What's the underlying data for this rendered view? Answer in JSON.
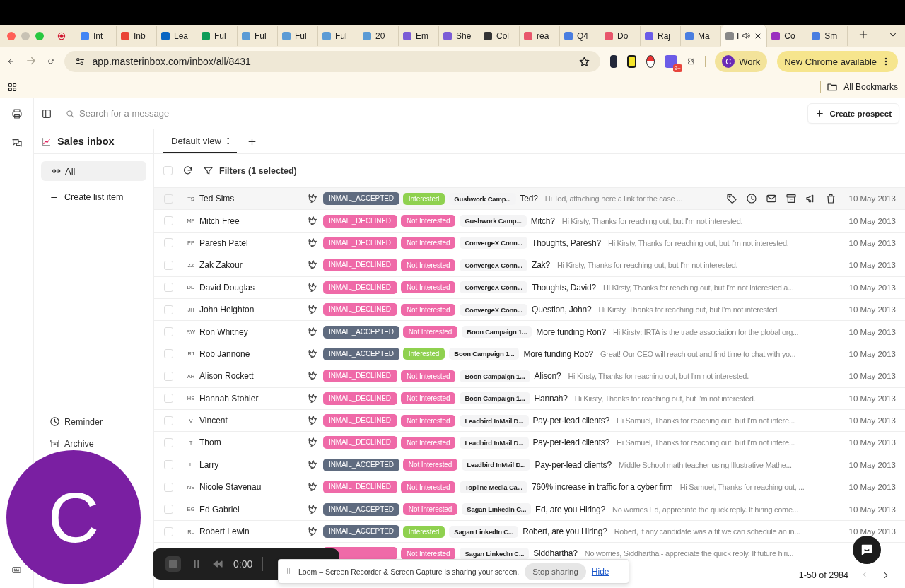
{
  "browser": {
    "tabs": [
      {
        "label": "Int",
        "color": "#4285f4",
        "selected": false
      },
      {
        "label": "Inb",
        "color": "#ea4335",
        "selected": false
      },
      {
        "label": "Lea",
        "color": "#0a66c2",
        "selected": false
      },
      {
        "label": "Ful",
        "color": "#0f9d58",
        "selected": false
      },
      {
        "label": "Ful",
        "color": "#5b9bd5",
        "selected": false
      },
      {
        "label": "Ful",
        "color": "#5b9bd5",
        "selected": false
      },
      {
        "label": "Ful",
        "color": "#5b9bd5",
        "selected": false
      },
      {
        "label": "20",
        "color": "#5b9bd5",
        "selected": false
      },
      {
        "label": "Em",
        "color": "#7b5cd6",
        "selected": false
      },
      {
        "label": "She",
        "color": "#7b5cd6",
        "selected": false
      },
      {
        "label": "Col",
        "color": "#333333",
        "selected": false
      },
      {
        "label": "rea",
        "color": "#e8566b",
        "selected": false
      },
      {
        "label": "Q4",
        "color": "#4a7ee0",
        "selected": false
      },
      {
        "label": "Do",
        "color": "#e8566b",
        "selected": false
      },
      {
        "label": "Raj",
        "color": "#6b5ce7",
        "selected": false
      },
      {
        "label": "Ma",
        "color": "#4a7ee0",
        "selected": false
      },
      {
        "label": "I",
        "color": "#888888",
        "selected": true
      },
      {
        "label": "Co",
        "color": "#9b2fbf",
        "selected": false
      },
      {
        "label": "Sm",
        "color": "#4a7ee0",
        "selected": false
      }
    ],
    "url": "app.masterinbox.com/inbox/all/8431",
    "extension_badge": "9+",
    "profile": {
      "initial": "C",
      "label": "Work"
    },
    "update_button": "New Chrome available",
    "bookmarks_label": "All Bookmarks"
  },
  "topbar": {
    "search_placeholder": "Search for a message",
    "create_button": "Create prospect"
  },
  "sidebar": {
    "title": "Sales inbox",
    "items": [
      {
        "label": "All",
        "selected": true
      }
    ],
    "create_label": "Create list item",
    "bottom_items": [
      {
        "kind": "reminder",
        "label": "Reminder"
      },
      {
        "kind": "archive",
        "label": "Archive"
      }
    ]
  },
  "views": [
    {
      "label": "Default view",
      "selected": true
    }
  ],
  "toolbar": {
    "select_all_checked": false,
    "filters_label": "Filters (1 selected)"
  },
  "rows": [
    {
      "initials": "TS",
      "name": "Ted Sims",
      "status": {
        "text": "INMAIL_ACCEPTED",
        "color": "#5f6b7f"
      },
      "label": {
        "text": "Interested",
        "color": "#8fd14f"
      },
      "campaign": "Gushwork Camp...",
      "subject": "Ted?",
      "preview": "Hi Ted, attaching here a link for the case ...",
      "date": "10 May 2013",
      "checked": false,
      "hovered": true
    },
    {
      "initials": "MF",
      "name": "Mitch Free",
      "status": {
        "text": "INMAIL_DECLINED",
        "color": "#ef6aa8"
      },
      "label": {
        "text": "Not Interested",
        "color": "#ef6aa8"
      },
      "campaign": "Gushwork Camp...",
      "subject": "Mitch?",
      "preview": "Hi Kirsty, Thanks for reaching out, but I'm not interested.",
      "date": "10 May 2013",
      "checked": false,
      "hovered": false
    },
    {
      "initials": "PP",
      "name": "Paresh Patel",
      "status": {
        "text": "INMAIL_DECLINED",
        "color": "#ef6aa8"
      },
      "label": {
        "text": "Not Interested",
        "color": "#ef6aa8"
      },
      "campaign": "ConvergeX Conn...",
      "subject": "Thoughts, Paresh?",
      "preview": "Hi Kirsty, Thanks for reaching out, but I'm not interested.",
      "date": "10 May 2013",
      "checked": false,
      "hovered": false
    },
    {
      "initials": "ZZ",
      "name": "Zak Zakour",
      "status": {
        "text": "INMAIL_DECLINED",
        "color": "#ef6aa8"
      },
      "label": {
        "text": "Not Interested",
        "color": "#ef6aa8"
      },
      "campaign": "ConvergeX Conn...",
      "subject": "Zak?",
      "preview": "Hi Kirsty, Thanks for reaching out, but I'm not interested.",
      "date": "10 May 2013",
      "checked": false,
      "hovered": false
    },
    {
      "initials": "DD",
      "name": "David Douglas",
      "status": {
        "text": "INMAIL_DECLINED",
        "color": "#ef6aa8"
      },
      "label": {
        "text": "Not Interested",
        "color": "#ef6aa8"
      },
      "campaign": "ConvergeX Conn...",
      "subject": "Thoughts, David?",
      "preview": "Hi Kirsty, Thanks for reaching out, but I'm not interested a...",
      "date": "10 May 2013",
      "checked": false,
      "hovered": false
    },
    {
      "initials": "JH",
      "name": "John Heighton",
      "status": {
        "text": "INMAIL_DECLINED",
        "color": "#ef6aa8"
      },
      "label": {
        "text": "Not Interested",
        "color": "#ef6aa8"
      },
      "campaign": "ConvergeX Conn...",
      "subject": "Question, John?",
      "preview": "Hi Kirsty, Thanks for reaching out, but I'm not interested.",
      "date": "10 May 2013",
      "checked": false,
      "hovered": false
    },
    {
      "initials": "RW",
      "name": "Ron Whitney",
      "status": {
        "text": "INMAIL_ACCEPTED",
        "color": "#5f6b7f"
      },
      "label": {
        "text": "Not Interested",
        "color": "#ef6aa8"
      },
      "campaign": "Boon Campaign 1...",
      "subject": "More funding Ron?",
      "preview": "Hi Kirsty: IRTA is the trade association for the global org...",
      "date": "10 May 2013",
      "checked": false,
      "hovered": false
    },
    {
      "initials": "RJ",
      "name": "Rob Jannone",
      "status": {
        "text": "INMAIL_ACCEPTED",
        "color": "#5f6b7f"
      },
      "label": {
        "text": "Interested",
        "color": "#8fd14f"
      },
      "campaign": "Boon Campaign 1...",
      "subject": "More funding Rob?",
      "preview": "Great! Our CEO will reach out and find time to chat with yo...",
      "date": "10 May 2013",
      "checked": false,
      "hovered": false
    },
    {
      "initials": "AR",
      "name": "Alison Rockett",
      "status": {
        "text": "INMAIL_DECLINED",
        "color": "#ef6aa8"
      },
      "label": {
        "text": "Not Interested",
        "color": "#ef6aa8"
      },
      "campaign": "Boon Campaign 1...",
      "subject": "Alison?",
      "preview": "Hi Kirsty, Thanks for reaching out, but I'm not interested.",
      "date": "10 May 2013",
      "checked": false,
      "hovered": false
    },
    {
      "initials": "HS",
      "name": "Hannah Stohler",
      "status": {
        "text": "INMAIL_DECLINED",
        "color": "#ef6aa8"
      },
      "label": {
        "text": "Not Interested",
        "color": "#ef6aa8"
      },
      "campaign": "Boon Campaign 1...",
      "subject": "Hannah?",
      "preview": "Hi Kirsty, Thanks for reaching out, but I'm not interested.",
      "date": "10 May 2013",
      "checked": false,
      "hovered": false
    },
    {
      "initials": "V",
      "name": "Vincent",
      "status": {
        "text": "INMAIL_DECLINED",
        "color": "#ef6aa8"
      },
      "label": {
        "text": "Not Interested",
        "color": "#ef6aa8"
      },
      "campaign": "Leadbird InMail D...",
      "subject": "Pay-per-lead clients?",
      "preview": "Hi Samuel, Thanks for reaching out, but I'm not intere...",
      "date": "10 May 2013",
      "checked": false,
      "hovered": false
    },
    {
      "initials": "T",
      "name": "Thom",
      "status": {
        "text": "INMAIL_DECLINED",
        "color": "#ef6aa8"
      },
      "label": {
        "text": "Not Interested",
        "color": "#ef6aa8"
      },
      "campaign": "Leadbird InMail D...",
      "subject": "Pay-per-lead clients?",
      "preview": "Hi Samuel, Thanks for reaching out, but I'm not intere...",
      "date": "10 May 2013",
      "checked": false,
      "hovered": false
    },
    {
      "initials": "L",
      "name": "Larry",
      "status": {
        "text": "INMAIL_ACCEPTED",
        "color": "#5f6b7f"
      },
      "label": {
        "text": "Not Interested",
        "color": "#ef6aa8"
      },
      "campaign": "Leadbird InMail D...",
      "subject": "Pay-per-lead clients?",
      "preview": "Middle School math teacher using Illustrative Mathe...",
      "date": "10 May 2013",
      "checked": false,
      "hovered": false
    },
    {
      "initials": "NS",
      "name": "Nicole Stavenau",
      "status": {
        "text": "INMAIL_DECLINED",
        "color": "#ef6aa8"
      },
      "label": {
        "text": "Not Interested",
        "color": "#ef6aa8"
      },
      "campaign": "Topline Media Ca...",
      "subject": "760% increase in traffic for a cyber firm",
      "preview": "Hi Samuel, Thanks for reaching out, ...",
      "date": "10 May 2013",
      "checked": false,
      "hovered": false
    },
    {
      "initials": "EG",
      "name": "Ed Gabriel",
      "status": {
        "text": "INMAIL_ACCEPTED",
        "color": "#5f6b7f"
      },
      "label": {
        "text": "Not Interested",
        "color": "#ef6aa8"
      },
      "campaign": "Sagan LinkedIn C...",
      "subject": "Ed, are you Hiring?",
      "preview": "No worries Ed, appreciate the quick reply. If hiring come...",
      "date": "10 May 2013",
      "checked": false,
      "hovered": false
    },
    {
      "initials": "RL",
      "name": "Robert Lewin",
      "status": {
        "text": "INMAIL_ACCEPTED",
        "color": "#5f6b7f"
      },
      "label": {
        "text": "Interested",
        "color": "#8fd14f"
      },
      "campaign": "Sagan LinkedIn C...",
      "subject": "Robert, are you Hiring?",
      "preview": "Robert, if any candidate was a fit we can schedule an in...",
      "date": "10 May 2013",
      "checked": false,
      "hovered": false
    },
    {
      "status": {
        "color": "#ef6aa8"
      },
      "label": {
        "text": "Not Interested",
        "color": "#ef6aa8"
      },
      "campaign": "Sagan LinkedIn C...",
      "subject": "Siddhartha?",
      "preview": "No worries, Siddhartha - appreciate the quick reply. If future hiri...",
      "hovered": false
    }
  ],
  "pagination": {
    "range": "1-50 of 2984"
  },
  "recorder": {
    "camera_initial": "C",
    "timer": "0:00",
    "banner_text": "Loom – Screen Recorder & Screen Capture is sharing your screen.",
    "stop_button": "Stop sharing",
    "hide_link": "Hide"
  }
}
